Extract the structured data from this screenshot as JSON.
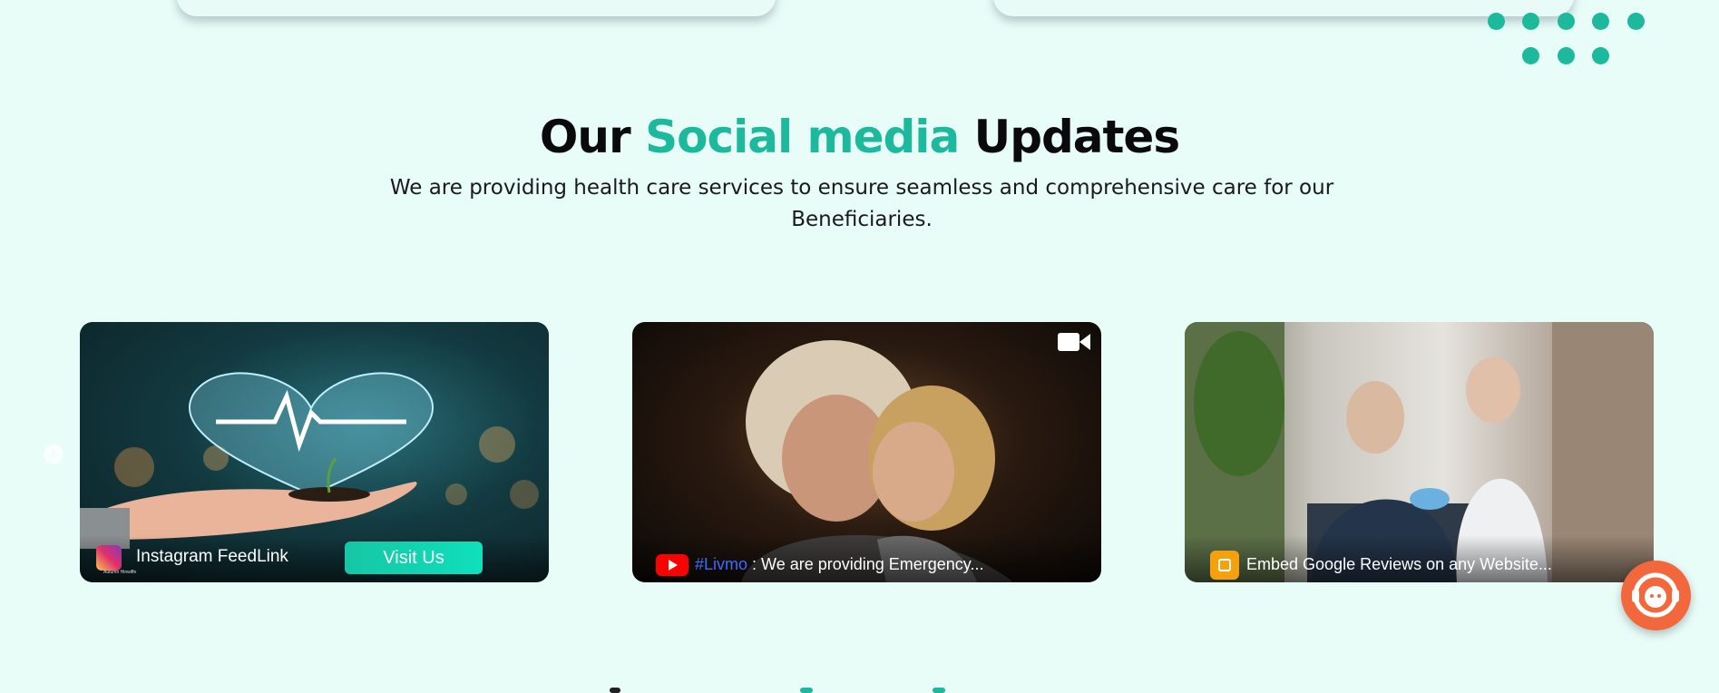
{
  "section": {
    "heading_part1": "Our ",
    "heading_accent": "Social media",
    "heading_part2": " Updates",
    "subtitle": "We are providing  health care services to ensure seamless and comprehensive care for our Beneficiaries."
  },
  "cards": [
    {
      "caption": "Instagram FeedLink",
      "button_label": "Visit Us",
      "icon": "instagram-icon",
      "footer_text": "Autumn Hinwiffe"
    },
    {
      "hashtag": "#Livmo",
      "caption": " : We are providing Emergency...",
      "icon": "youtube-icon",
      "corner_icon": "video-camera-icon"
    },
    {
      "caption": "Embed Google Reviews on any Website...",
      "icon": "blogger-icon"
    }
  ],
  "nav": {
    "prev_icon": "chevron-left-icon"
  },
  "chat": {
    "icon": "chat-support-icon"
  },
  "colors": {
    "accent": "#1db99d",
    "background": "#e8fdf8",
    "chat": "#f2683c",
    "button": "#16c6a4"
  }
}
